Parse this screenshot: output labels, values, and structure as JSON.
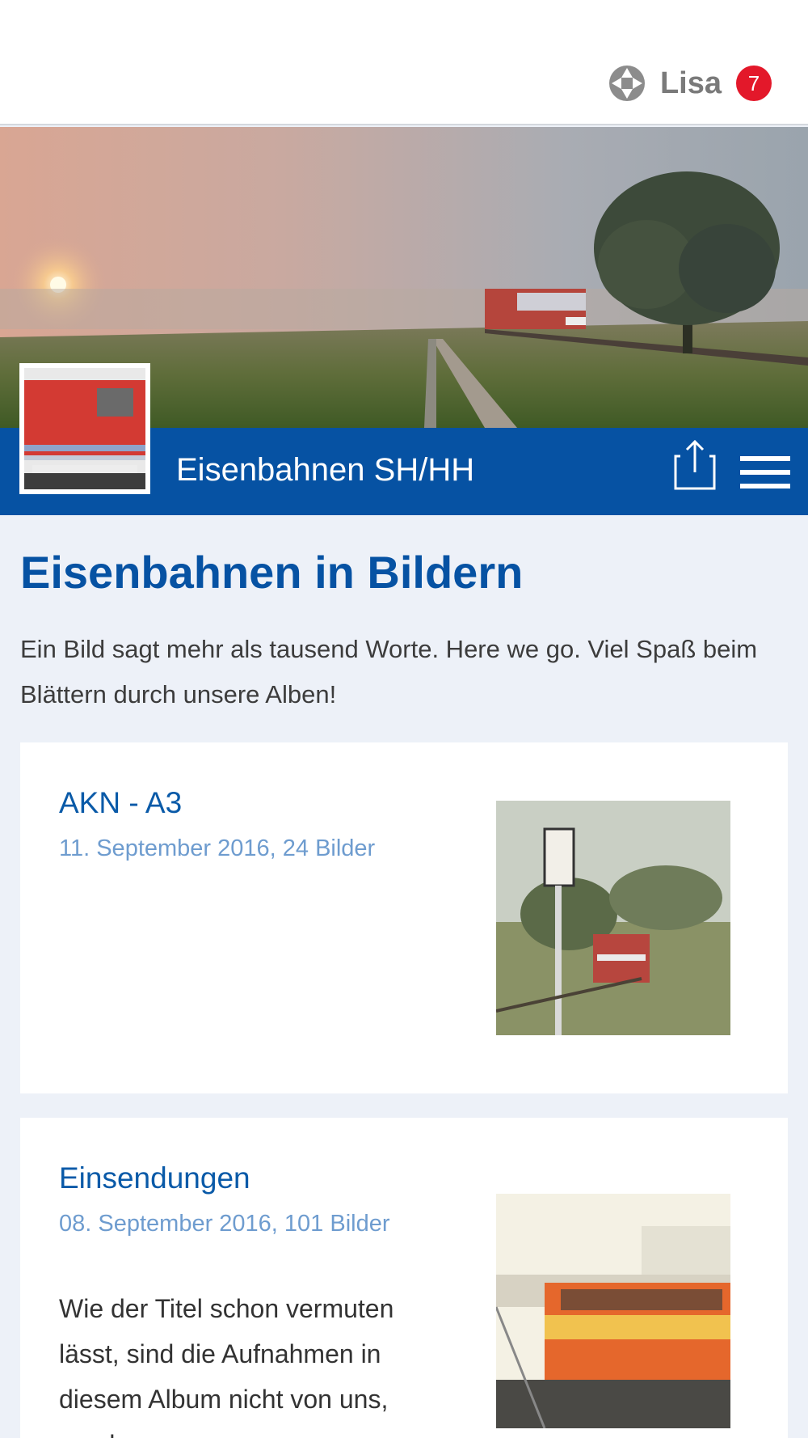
{
  "header": {
    "user_name": "Lisa",
    "notification_count": "7",
    "icons": {
      "logo": "app-logo-icon"
    }
  },
  "group": {
    "name": "Eisenbahnen SH/HH",
    "icons": {
      "share": "share-icon",
      "menu": "hamburger-menu-icon"
    }
  },
  "page": {
    "title": "Eisenbahnen in Bildern",
    "intro": "Ein Bild sagt mehr als tausend Worte. Here we go. Viel Spaß beim Blättern durch unsere Alben!"
  },
  "albums": [
    {
      "title": "AKN - A3",
      "meta": "11. September 2016, 24 Bilder",
      "description": ""
    },
    {
      "title": "Einsendungen",
      "meta": "08. September 2016, 101 Bilder",
      "description": "Wie der Titel schon vermuten lässt, sind die Aufnahmen in diesem Album nicht von uns, sondern"
    }
  ],
  "colors": {
    "brand_blue": "#0652a3",
    "badge_red": "#e3182a",
    "meta_blue": "#6e9ccf",
    "page_bg": "#edf1f8"
  }
}
